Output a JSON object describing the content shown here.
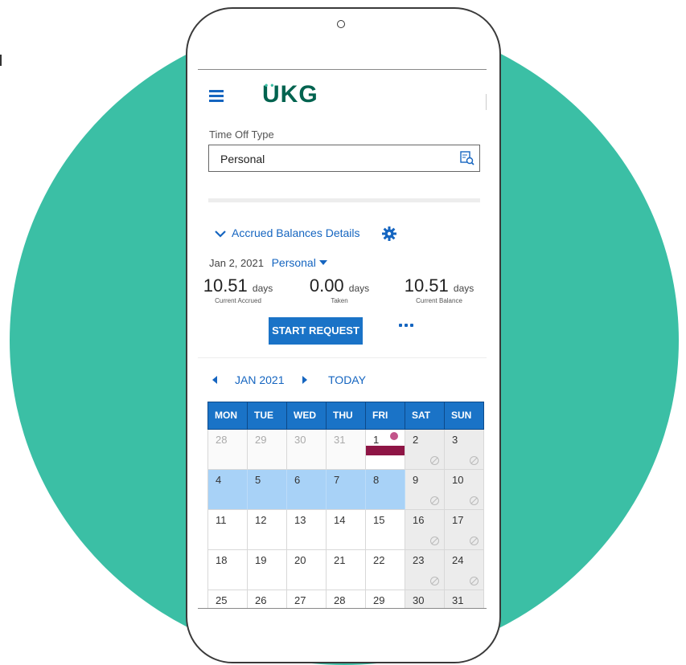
{
  "app": {
    "logo_text": "UKG",
    "colors": {
      "brand_blue": "#1a73c7",
      "logo_green": "#00634f",
      "teal_background": "#3bbfa5",
      "holiday": "#8e1545",
      "selected_day": "#a8d2f7"
    }
  },
  "header": {
    "menu_icon": "hamburger-menu-icon"
  },
  "time_off": {
    "label": "Time Off Type",
    "value": "Personal",
    "lookup_icon": "lookup-search-icon"
  },
  "accrued": {
    "toggle_label": "Accrued Balances Details",
    "settings_icon": "gear-icon",
    "date": "Jan 2, 2021",
    "type": "Personal",
    "stats": [
      {
        "value": "10.51",
        "unit": "days",
        "caption": "Current Accrued"
      },
      {
        "value": "0.00",
        "unit": "days",
        "caption": "Taken"
      },
      {
        "value": "10.51",
        "unit": "days",
        "caption": "Current Balance"
      }
    ],
    "start_request_label": "START REQUEST",
    "more_icon": "more-options-icon"
  },
  "calendar": {
    "month_label": "JAN 2021",
    "today_label": "TODAY",
    "weekdays": [
      "MON",
      "TUE",
      "WED",
      "THU",
      "FRI",
      "SAT",
      "SUN"
    ],
    "weeks": [
      [
        "28",
        "29",
        "30",
        "31",
        "1",
        "2",
        "3"
      ],
      [
        "4",
        "5",
        "6",
        "7",
        "8",
        "9",
        "10"
      ],
      [
        "11",
        "12",
        "13",
        "14",
        "15",
        "16",
        "17"
      ],
      [
        "18",
        "19",
        "20",
        "21",
        "22",
        "23",
        "24"
      ],
      [
        "25",
        "26",
        "27",
        "28",
        "29",
        "30",
        "31"
      ]
    ]
  }
}
